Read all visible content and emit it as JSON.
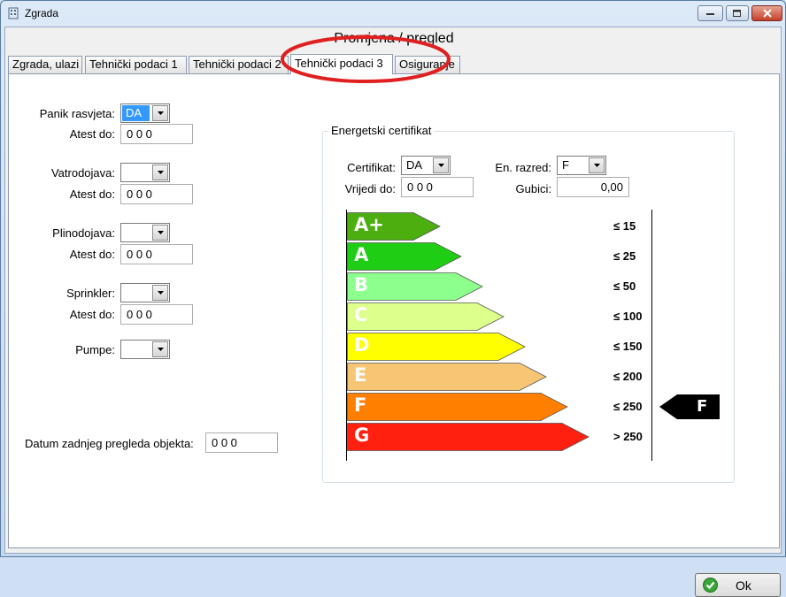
{
  "window": {
    "title": "Zgrada"
  },
  "form_header": "Promjena / pregled",
  "tabs": [
    {
      "label": "Zgrada, ulazi"
    },
    {
      "label": "Tehnički podaci 1"
    },
    {
      "label": "Tehnički podaci 2"
    },
    {
      "label": "Tehnički podaci 3",
      "active": true
    },
    {
      "label": "Osiguranje"
    }
  ],
  "left": {
    "panik_label": "Panik rasvjeta:",
    "panik_value": "DA",
    "atest1_label": "Atest do:",
    "atest1_value": "0 0 0",
    "vatro_label": "Vatrodojava:",
    "vatro_value": "",
    "atest2_label": "Atest do:",
    "atest2_value": "0 0 0",
    "plino_label": "Plinodojava:",
    "plino_value": "",
    "atest3_label": "Atest do:",
    "atest3_value": "0 0 0",
    "sprinkler_label": "Sprinkler:",
    "sprinkler_value": "",
    "atest4_label": "Atest do:",
    "atest4_value": "0 0 0",
    "pumpe_label": "Pumpe:",
    "pumpe_value": ""
  },
  "datum": {
    "label": "Datum zadnjeg pregleda objekta:",
    "value": "0 0 0"
  },
  "energy": {
    "legend": "Energetski certifikat",
    "certifikat_label": "Certifikat:",
    "certifikat_value": "DA",
    "razred_label": "En. razred:",
    "razred_value": "F",
    "vrijedi_label": "Vrijedi do:",
    "vrijedi_value": "0 0 0",
    "gubici_label": "Gubici:",
    "gubici_value": "0,00",
    "bands": [
      {
        "letter": "A+",
        "limit": "≤ 15",
        "color": "#4caf0f"
      },
      {
        "letter": "A",
        "limit": "≤ 25",
        "color": "#1fce14"
      },
      {
        "letter": "B",
        "limit": "≤ 50",
        "color": "#8cff8c"
      },
      {
        "letter": "C",
        "limit": "≤ 100",
        "color": "#ddff8c"
      },
      {
        "letter": "D",
        "limit": "≤ 150",
        "color": "#ffff00"
      },
      {
        "letter": "E",
        "limit": "≤ 200",
        "color": "#f7c675"
      },
      {
        "letter": "F",
        "limit": "≤ 250",
        "color": "#ff8000"
      },
      {
        "letter": "G",
        "limit": "> 250",
        "color": "#ff2010"
      }
    ],
    "current_class": "F"
  },
  "footer": {
    "ok_label": "Ok"
  }
}
